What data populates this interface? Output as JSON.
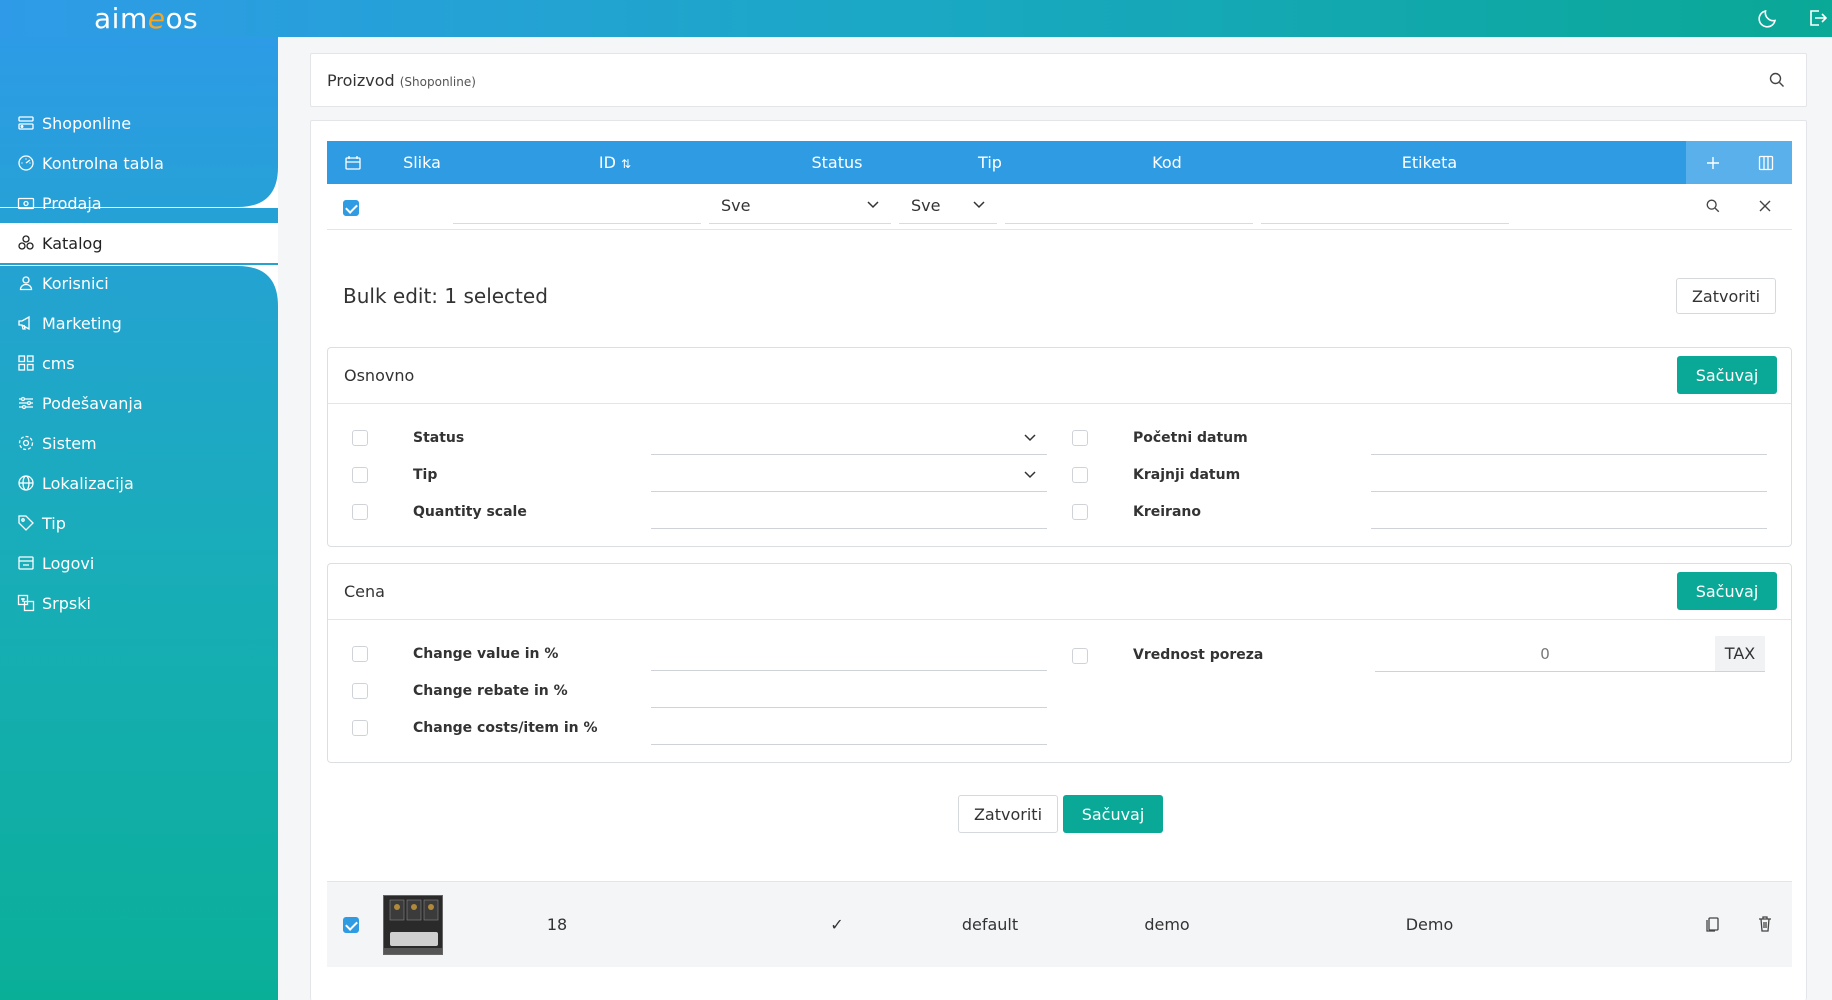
{
  "brand": {
    "logo_pre": "aim",
    "logo_e": "e",
    "logo_post": "os"
  },
  "sidebar": {
    "items": [
      {
        "label": "Shoponline",
        "icon": "store-icon"
      },
      {
        "label": "Kontrolna tabla",
        "icon": "dashboard-icon"
      },
      {
        "label": "Prodaja",
        "icon": "cash-icon"
      },
      {
        "label": "Katalog",
        "icon": "boxes-icon",
        "active": true
      },
      {
        "label": "Korisnici",
        "icon": "user-icon"
      },
      {
        "label": "Marketing",
        "icon": "megaphone-icon"
      },
      {
        "label": "cms",
        "icon": "grid-icon"
      },
      {
        "label": "Podešavanja",
        "icon": "sliders-icon"
      },
      {
        "label": "Sistem",
        "icon": "gear-icon"
      },
      {
        "label": "Lokalizacija",
        "icon": "globe-icon"
      },
      {
        "label": "Tip",
        "icon": "tag-icon"
      },
      {
        "label": "Logovi",
        "icon": "log-icon"
      },
      {
        "label": "Srpski",
        "icon": "translate-icon"
      }
    ]
  },
  "header": {
    "title": "Proizvod",
    "site": "(Shoponline)"
  },
  "table": {
    "columns": {
      "image": "Slika",
      "id": "ID",
      "status": "Status",
      "type": "Tip",
      "code": "Kod",
      "label": "Etiketa"
    },
    "filters": {
      "status": "Sve",
      "type": "Sve"
    }
  },
  "bulk": {
    "title": "Bulk edit: 1 selected",
    "close": "Zatvoriti",
    "save": "Sačuvaj"
  },
  "basic": {
    "title": "Osnovno",
    "save": "Sačuvaj",
    "fields": {
      "status": "Status",
      "type": "Tip",
      "scale": "Quantity scale",
      "start": "Početni datum",
      "end": "Krajnji datum",
      "created": "Kreirano"
    }
  },
  "price": {
    "title": "Cena",
    "save": "Sačuvaj",
    "fields": {
      "value": "Change value in %",
      "rebate": "Change rebate in %",
      "costs": "Change costs/item in %",
      "tax": "Vrednost poreza"
    },
    "tax_value": "0",
    "tax_unit": "TAX"
  },
  "rows": [
    {
      "id": "18",
      "status": "✓",
      "type": "default",
      "code": "demo",
      "label": "Demo",
      "checked": true
    }
  ],
  "colors": {
    "primary": "#2e9be3",
    "accent": "#0aa896"
  }
}
